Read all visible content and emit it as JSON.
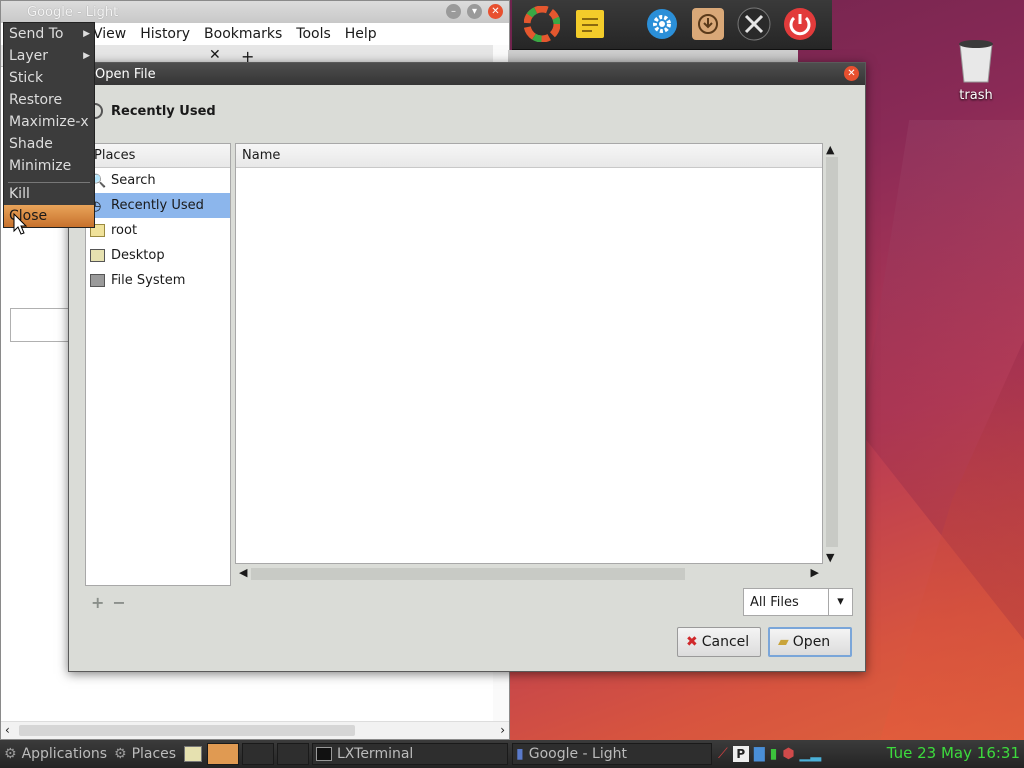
{
  "browser": {
    "title": "Google - Light",
    "menu": [
      "View",
      "History",
      "Bookmarks",
      "Tools",
      "Help"
    ]
  },
  "context_menu": {
    "items": [
      {
        "label": "Send To",
        "submenu": true
      },
      {
        "label": "Layer",
        "submenu": true
      },
      {
        "label": "Stick",
        "submenu": false
      },
      {
        "label": "Restore",
        "submenu": false
      },
      {
        "label": "Maximize-x",
        "submenu": false
      },
      {
        "label": "Shade",
        "submenu": false
      },
      {
        "label": "Minimize",
        "submenu": false
      }
    ],
    "kill": "Kill",
    "close": "Close",
    "highlighted": "Close"
  },
  "dialog": {
    "title": "Open File",
    "location": "Recently Used",
    "places_header": "Places",
    "places": [
      {
        "label": "Search",
        "icon": "search-icon",
        "selected": false
      },
      {
        "label": "Recently Used",
        "icon": "clock-icon",
        "selected": true
      },
      {
        "label": "root",
        "icon": "folder-icon",
        "selected": false
      },
      {
        "label": "Desktop",
        "icon": "desktop-icon",
        "selected": false
      },
      {
        "label": "File System",
        "icon": "drive-icon",
        "selected": false
      }
    ],
    "files_header": "Name",
    "filter": "All Files",
    "cancel": "Cancel",
    "open": "Open"
  },
  "desktop": {
    "trash_label": "trash"
  },
  "taskbar": {
    "applications": "Applications",
    "places": "Places",
    "terminal": "LXTerminal",
    "browser_task": "Google - Light",
    "clock": "Tue 23 May 16:31"
  },
  "colors": {
    "selection": "#8cb6ec",
    "menu_highlight": "#d98a3f",
    "clock": "#3ddb3d",
    "close_button": "#e8502f"
  }
}
